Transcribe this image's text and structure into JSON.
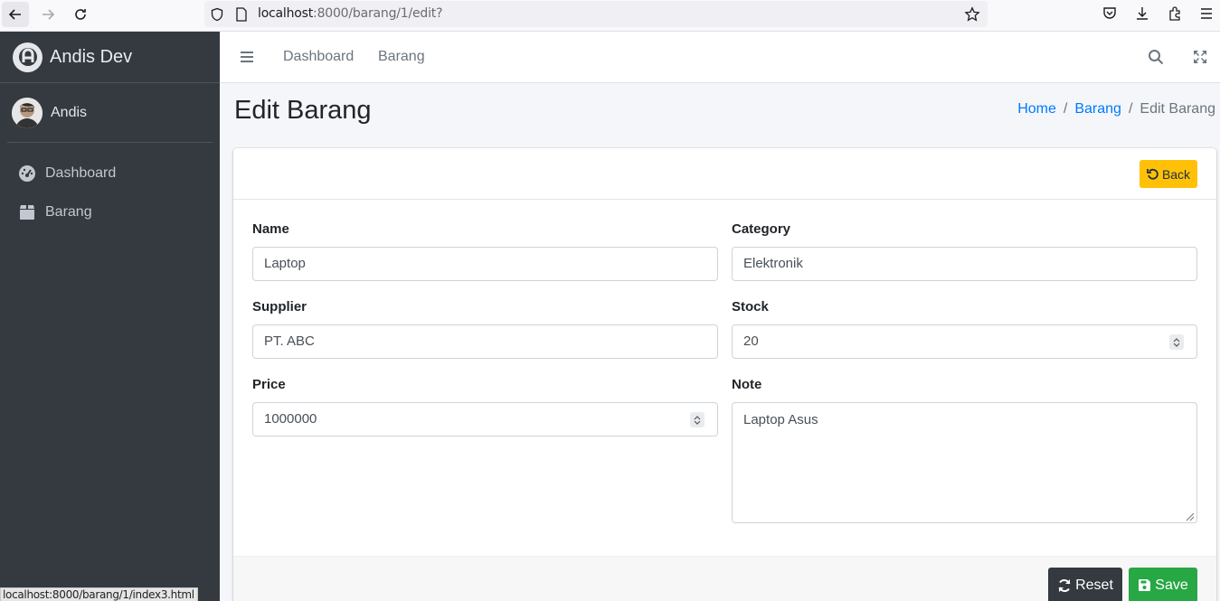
{
  "browser": {
    "url_host": "localhost",
    "url_rest": ":8000/barang/1/edit?",
    "icons": [
      "back-arrow-icon",
      "forward-arrow-icon",
      "reload-icon",
      "shield-icon",
      "page-icon",
      "star-icon",
      "pocket-icon",
      "download-icon",
      "extensions-icon",
      "menu-icon"
    ]
  },
  "sidebar": {
    "brand": "Andis Dev",
    "user": "Andis",
    "items": [
      {
        "label": "Dashboard",
        "icon": "dashboard-gauge-icon"
      },
      {
        "label": "Barang",
        "icon": "box-icon"
      }
    ]
  },
  "topbar": {
    "links": [
      "Dashboard",
      "Barang"
    ],
    "icons": [
      "hamburger-icon",
      "search-icon",
      "fullscreen-icon"
    ]
  },
  "header": {
    "title": "Edit Barang",
    "breadcrumb": [
      "Home",
      "Barang",
      "Edit Barang"
    ]
  },
  "card": {
    "back_label": "Back",
    "fields": {
      "name": {
        "label": "Name",
        "value": "Laptop"
      },
      "category": {
        "label": "Category",
        "value": "Elektronik"
      },
      "supplier": {
        "label": "Supplier",
        "value": "PT. ABC"
      },
      "stock": {
        "label": "Stock",
        "value": "20"
      },
      "price": {
        "label": "Price",
        "value": "1000000"
      },
      "note": {
        "label": "Note",
        "value": "Laptop Asus"
      }
    },
    "reset_label": "Reset",
    "save_label": "Save"
  },
  "status_bar": "localhost:8000/barang/1/index3.html",
  "colors": {
    "sidebar_bg": "#343a40",
    "link": "#007bff",
    "warning": "#ffc107",
    "success": "#28a745",
    "dark": "#343a40"
  }
}
